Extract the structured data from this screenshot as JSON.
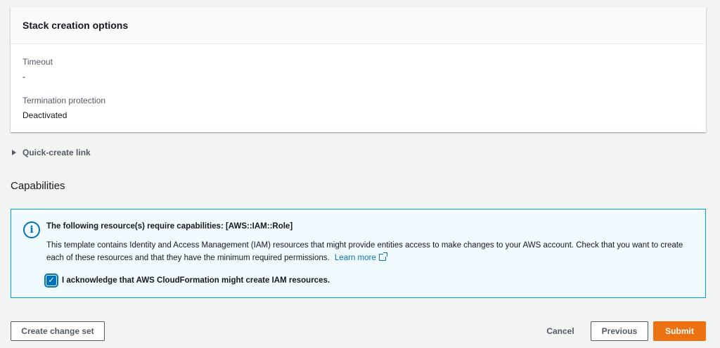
{
  "panel": {
    "title": "Stack creation options",
    "fields": [
      {
        "label": "Timeout",
        "value": "-"
      },
      {
        "label": "Termination protection",
        "value": "Deactivated"
      }
    ]
  },
  "expander": {
    "label": "Quick-create link"
  },
  "capabilities": {
    "heading": "Capabilities",
    "alert": {
      "icon": "info-icon",
      "title": "The following resource(s) require capabilities: [AWS::IAM::Role]",
      "body": "This template contains Identity and Access Management (IAM) resources that might provide entities access to make changes to your AWS account. Check that you want to create each of these resources and that they have the minimum required permissions.",
      "link_label": "Learn more",
      "ack_label": "I acknowledge that AWS CloudFormation might create IAM resources.",
      "ack_checked": true
    }
  },
  "footer": {
    "create_change_set": "Create change set",
    "cancel": "Cancel",
    "previous": "Previous",
    "submit": "Submit"
  },
  "colors": {
    "primary": "#ec7211",
    "link": "#0073bb",
    "info_bg": "#f1faff",
    "info_border": "#00a1c9"
  }
}
